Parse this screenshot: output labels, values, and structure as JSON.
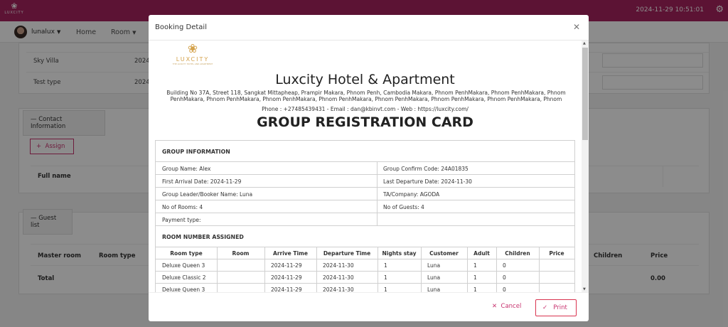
{
  "app": {
    "logo_text": "LUXCITY",
    "datetime": "2024-11-29 10:51:01"
  },
  "nav": {
    "user": "lunalux",
    "home": "Home",
    "room": "Room"
  },
  "background": {
    "rows": [
      {
        "name": "Sky Villa",
        "value": "2024"
      },
      {
        "name": "Test type",
        "value": "2024"
      }
    ],
    "contact_section": "Contact Information",
    "assign": "Assign",
    "full_name": "Full name",
    "guest_section": "Guest list",
    "columns": [
      "Master room",
      "Room type"
    ],
    "right_columns": [
      "Children",
      "Price"
    ],
    "total": "Total",
    "total_value": "0.00"
  },
  "modal": {
    "title": "Booking Detail",
    "cancel": "Cancel",
    "print": "Print"
  },
  "document": {
    "logo_word": "LUXCITY",
    "logo_sub": "THE LUXCITY HOTEL AND APARTMENT",
    "hotel_name": "Luxcity Hotel & Apartment",
    "address": "Building No 37A, Street 118, Sangkat Mittapheap, Prampir Makara, Phnom Penh, Cambodia Makara, Phnom PenhMakara, Phnom PenhMakara, Phnom PenhMakara, Phnom PenhMakara, Phnom PenhMakara, Phnom PenhMakara, Phnom PenhMakara, Phnom PenhMakara, Phnom PenhMakara, Phnom",
    "contact": "Phone : +27485439431 - Email : dan@kbinvt.com - Web : https://luxcity.com/",
    "card_title": "GROUP REGISTRATION CARD",
    "group_section": "GROUP INFORMATION",
    "group_rows": [
      {
        "left": "Group Name: Alex",
        "right": "Group Confirm Code: 24A01835"
      },
      {
        "left": "First Arrival Date: 2024-11-29",
        "right": "Last Departure Date: 2024-11-30"
      },
      {
        "left": "Group Leader/Booker Name: Luna",
        "right": "TA/Company: AGODA"
      },
      {
        "left": "No of Rooms: 4",
        "right": "No of Guests: 4"
      },
      {
        "left": "Payment type:",
        "right": ""
      }
    ],
    "room_section": "ROOM NUMBER ASSIGNED",
    "room_headers": [
      "Room type",
      "Room",
      "Arrive Time",
      "Departure Time",
      "Nights stay",
      "Customer",
      "Adult",
      "Children",
      "Price"
    ],
    "room_rows": [
      [
        "Deluxe Queen 3",
        "",
        "2024-11-29",
        "2024-11-30",
        "1",
        "Luna",
        "1",
        "0",
        ""
      ],
      [
        "Deluxe Classic 2",
        "",
        "2024-11-29",
        "2024-11-30",
        "1",
        "Luna",
        "1",
        "0",
        ""
      ],
      [
        "Deluxe Queen 3",
        "",
        "2024-11-29",
        "2024-11-30",
        "1",
        "Luna",
        "1",
        "0",
        ""
      ]
    ]
  }
}
